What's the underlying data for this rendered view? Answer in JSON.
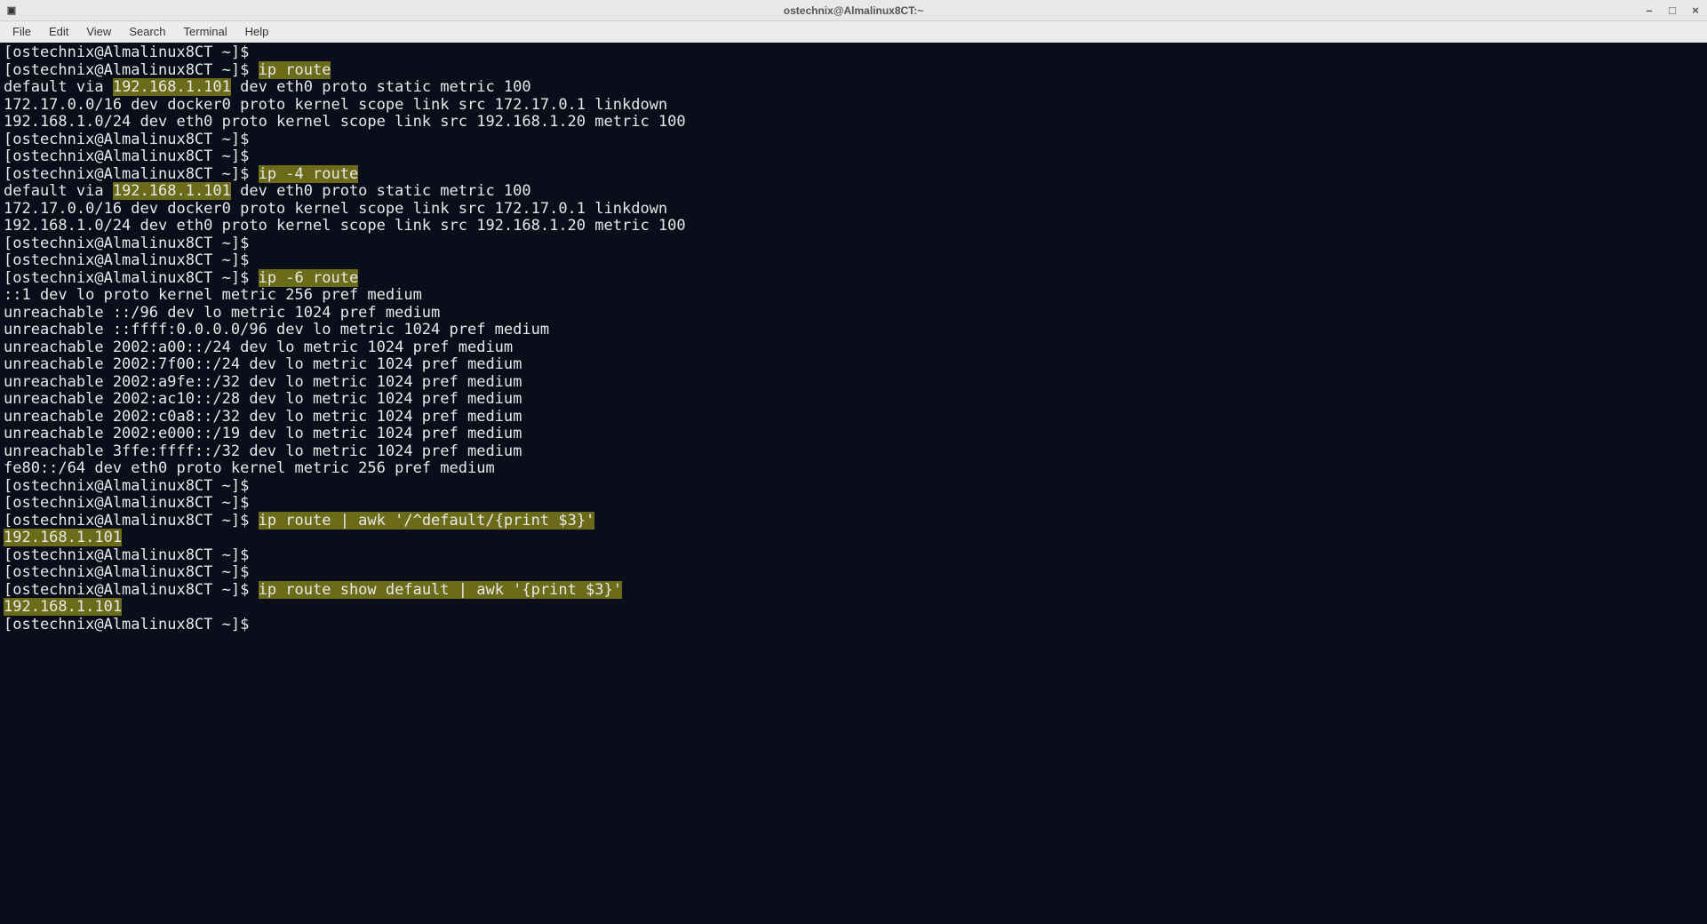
{
  "window": {
    "title": "ostechnix@Almalinux8CT:~"
  },
  "menu": {
    "file": "File",
    "edit": "Edit",
    "view": "View",
    "search": "Search",
    "terminal": "Terminal",
    "help": "Help"
  },
  "prompt": "[ostechnix@Almalinux8CT ~]$",
  "cmd": {
    "ip_route": "ip route",
    "ip4_route": "ip -4 route",
    "ip6_route": "ip -6 route",
    "awk_default": "ip route | awk '/^default/{print $3}'",
    "awk_show_default": "ip route show default | awk '{print $3}'"
  },
  "gateway_ip": "192.168.1.101",
  "out": {
    "r1_a": "default via ",
    "r1_b": " dev eth0 proto static metric 100",
    "r2": "172.17.0.0/16 dev docker0 proto kernel scope link src 172.17.0.1 linkdown",
    "r3": "192.168.1.0/24 dev eth0 proto kernel scope link src 192.168.1.20 metric 100",
    "v6_1": "::1 dev lo proto kernel metric 256 pref medium",
    "v6_2": "unreachable ::/96 dev lo metric 1024 pref medium",
    "v6_3": "unreachable ::ffff:0.0.0.0/96 dev lo metric 1024 pref medium",
    "v6_4": "unreachable 2002:a00::/24 dev lo metric 1024 pref medium",
    "v6_5": "unreachable 2002:7f00::/24 dev lo metric 1024 pref medium",
    "v6_6": "unreachable 2002:a9fe::/32 dev lo metric 1024 pref medium",
    "v6_7": "unreachable 2002:ac10::/28 dev lo metric 1024 pref medium",
    "v6_8": "unreachable 2002:c0a8::/32 dev lo metric 1024 pref medium",
    "v6_9": "unreachable 2002:e000::/19 dev lo metric 1024 pref medium",
    "v6_10": "unreachable 3ffe:ffff::/32 dev lo metric 1024 pref medium",
    "v6_11": "fe80::/64 dev eth0 proto kernel metric 256 pref medium"
  }
}
